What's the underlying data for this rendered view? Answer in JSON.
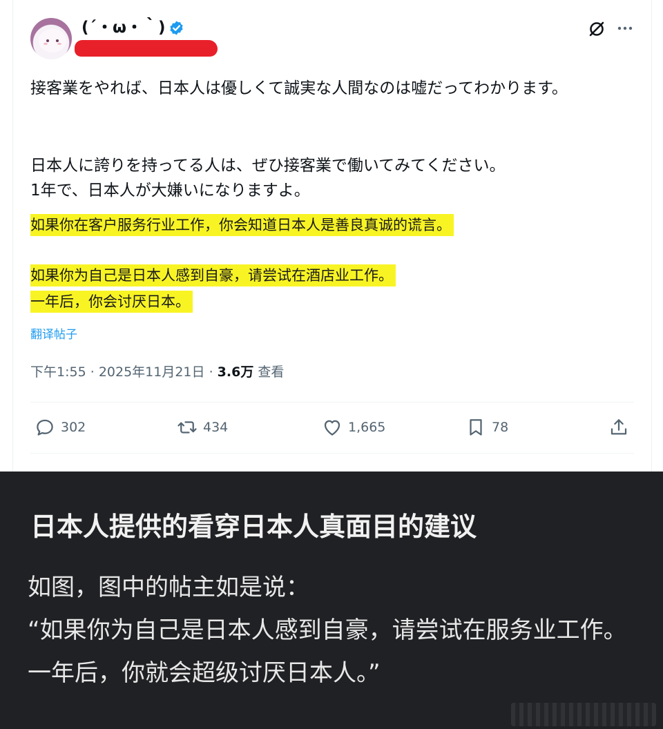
{
  "tweet": {
    "display_name": "(´・ω・｀)",
    "paragraph1": "接客業をやれば、日本人は優しくて誠実な人間なのは嘘だってわかります。",
    "paragraph2_line1": "日本人に誇りを持ってる人は、ぜひ接客業で働いてみてください。",
    "paragraph2_line2": "1年で、日本人が大嫌いになりますよ。",
    "highlight_lines": [
      "如果你在客户服务行业工作，你会知道日本人是善良真诚的谎言。",
      "如果你为自己是日本人感到自豪，请尝试在酒店业工作。",
      "一年后，你会讨厌日本。"
    ],
    "translate_label": "翻译帖子",
    "time": "下午1:55",
    "dot": "·",
    "date": "2025年11月21日",
    "views_count": "3.6万",
    "views_label": "查看",
    "actions": {
      "replies": "302",
      "reposts": "434",
      "likes": "1,665",
      "bookmarks": "78"
    },
    "icons": [
      "avatar",
      "verified-badge-icon",
      "grok-icon",
      "more-icon",
      "reply-icon",
      "repost-icon",
      "like-icon",
      "bookmark-icon",
      "share-icon"
    ],
    "colors": {
      "verified": "#1d9bf0",
      "highlight": "#f8f424",
      "redaction": "#e8202a",
      "link": "#1d9bf0"
    }
  },
  "caption": {
    "headline": "日本人提供的看穿日本人真面目的建议",
    "line1": "如图，图中的帖主如是说：",
    "line2": "“如果你为自己是日本人感到自豪，请尝试在服务业工作。一年后，你就会超级讨厌日本人。”",
    "background": "#202124"
  }
}
